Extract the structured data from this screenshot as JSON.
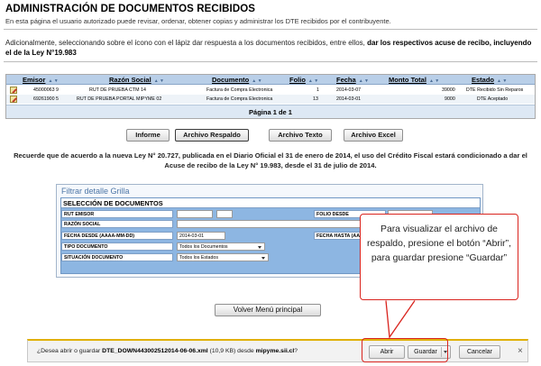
{
  "header": {
    "title": "ADMINISTRACIÓN DE DOCUMENTOS RECIBIDOS",
    "subtitle": "En esta página el usuario autorizado puede revisar, ordenar, obtener copias y administrar los DTE recibidos por el contribuyente."
  },
  "notice": {
    "text": "Adicionalmente, seleccionando sobre el ícono con el lápiz dar respuesta a los documentos recibidos, entre ellos, ",
    "bold": "dar los respectivos acuse de recibo, incluyendo el de la Ley N°19.983"
  },
  "table": {
    "columns": [
      "Emisor",
      "Razón Social",
      "Documento",
      "Folio",
      "Fecha",
      "Monto Total",
      "Estado"
    ],
    "sort_glyph": "▲ ▼",
    "rows": [
      {
        "emisor": "45000063 9",
        "razon_social": "RUT DE PRUEBA CTM 14",
        "documento": "Factura de Compra Electronica",
        "folio": "1",
        "fecha": "2014-03-07",
        "monto": "39000",
        "estado": "DTE Recibido Sin Reparos"
      },
      {
        "emisor": "69261900 5",
        "razon_social": "RUT DE PRUEBA PORTAL MIPYME 02",
        "documento": "Factura de Compra Electronica",
        "folio": "13",
        "fecha": "2014-03-01",
        "monto": "9000",
        "estado": "DTE Aceptado"
      }
    ],
    "pager": "Página 1 de 1"
  },
  "actions": {
    "informe": "Informe",
    "archivo_respaldo": "Archivo Respaldo",
    "archivo_texto": "Archivo Texto",
    "archivo_excel": "Archivo Excel"
  },
  "law_note": "Recuerde que de acuerdo a la nueva Ley N° 20.727, publicada en el Diario Oficial el 31 de enero de 2014, el uso del Crédito Fiscal estará condicionado a dar el Acuse de recibo de la Ley N° 19.983, desde el 31 de julio de 2014.",
  "filter": {
    "title": "Filtrar detalle Grilla",
    "section": "SELECCIÓN DE DOCUMENTOS",
    "rut_emisor_label": "RUT EMISOR",
    "folio_desde_label": "FOLIO DESDE",
    "razon_social_label": "RAZÓN SOCIAL",
    "fecha_desde_label": "FECHA DESDE (AAAA-MM-DD)",
    "fecha_desde_value": "2014-03-01",
    "fecha_hasta_label": "FECHA HASTA (AAAA",
    "tipo_documento_label": "TIPO DOCUMENTO",
    "tipo_documento_value": "Todos los Documentos",
    "situacion_label": "SITUACIÓN DOCUMENTO",
    "situacion_value": "Todos los Estados"
  },
  "back_button": "Volver Menú principal",
  "callout": {
    "text": "Para visualizar el archivo de respaldo, presione el botón “Abrir”, para guardar presione “Guardar”"
  },
  "download_bar": {
    "prefix": "¿Desea abrir o guardar ",
    "filename": "DTE_DOWN443002512014-06-06.xml",
    "size": " (10,9 KB) desde ",
    "host": "mipyme.sii.cl",
    "suffix": "?",
    "open": "Abrir",
    "save": "Guardar",
    "cancel": "Cancelar",
    "close_glyph": "×"
  },
  "colors": {
    "accent_red": "#d9241e",
    "header_blue": "#b9cfe8",
    "grid_blue": "#8db6e2"
  }
}
